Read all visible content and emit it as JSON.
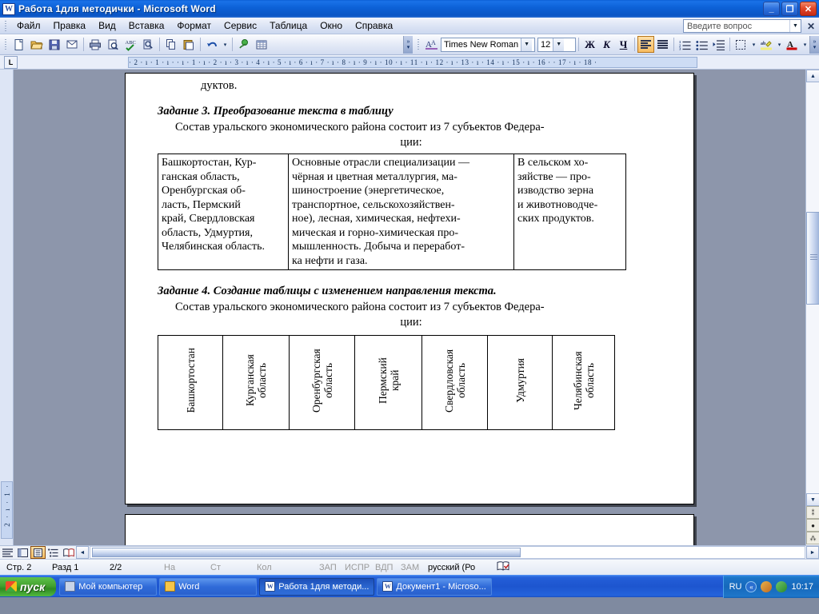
{
  "window": {
    "title": "Работа 1для методички - Microsoft Word",
    "icon": "word-document-icon",
    "minimize": "_",
    "maximize": "❐",
    "close": "✕"
  },
  "menu": {
    "items": [
      {
        "label": "Файл"
      },
      {
        "label": "Правка"
      },
      {
        "label": "Вид"
      },
      {
        "label": "Вставка"
      },
      {
        "label": "Формат"
      },
      {
        "label": "Сервис"
      },
      {
        "label": "Таблица"
      },
      {
        "label": "Окно"
      },
      {
        "label": "Справка"
      }
    ],
    "ask_placeholder": "Введите вопрос",
    "ask_close": "✕"
  },
  "toolbar": {
    "standard_icons": [
      "new-document-icon",
      "open-folder-icon",
      "save-icon",
      "email-icon",
      "print-icon",
      "print-preview-icon",
      "spelling-check-icon",
      "research-icon",
      "copy-icon",
      "paste-icon",
      "undo-icon",
      "undo-dropdown-icon",
      "insert-hyperlink-icon",
      "insert-table-icon"
    ],
    "overflow": "toolbar-options-icon",
    "font_name": "Times New Roman",
    "font_size": "12",
    "bold": "Ж",
    "italic": "К",
    "underline": "Ч",
    "align_left": "align-left-icon",
    "align_justify": "align-justify-icon",
    "numbered_list": "numbered-list-icon",
    "bulleted_list": "bulleted-list-icon",
    "increase_indent": "increase-indent-icon",
    "borders": "borders-icon",
    "highlight": "highlight-icon",
    "font_color": "font-color-icon",
    "dropdown_arrow": "▾"
  },
  "ruler": {
    "tab_selector": "L",
    "horizontal_marks": "·  2  ·  ı  ·  1  ·  ı  ·      ·  ı  ·  1  ·  ı  ·  2  ·  ı  ·  3  ·  ı  ·  4  ·  ı  ·  5  ·  ı  ·  6  ·  ı  ·  7  ·  ı  ·  8  ·  ı  ·  9  ·  ı  · 10 ·  ı  · 11 ·  ı  · 12 ·  ı  · 13 ·  ı  · 14 ·  ı  · 15 ·  ı  · 16 ·      · 17 ·  ı  · 18 ·",
    "vertical_marks": "2 · ı · 1 ·"
  },
  "document": {
    "continued_line": "дуктов.",
    "task3": {
      "heading": "Задание 3. Преобразование текста в таблицу",
      "intro": "Состав уральского экономического района состоит из 7 субъектов Федера-",
      "intro2": "ции:",
      "table": {
        "cells": [
          "Башкортостан, Кур-ганская область, Оренбургская об-ласть, Пермский край, Свердловская область, Удмуртия, Челябинская область.",
          "Основные отрасли специализации — чёрная и цветная металлургия, ма-шиностроение (энергетическое, транспортное, сельскохозяйствен-ное), лесная, химическая, нефтехи-мическая и горно-химическая про-мышленность. Добыча и переработ-ка нефти и газа.",
          "В сельском хо-зяйстве — про-изводство зерна и животноводче-ских продуктов."
        ],
        "cell0_lines": [
          "Башкортостан, Кур-",
          "ганская область,",
          "Оренбургская об-",
          "ласть, Пермский",
          "край, Свердловская",
          "область, Удмуртия,",
          "Челябинская область."
        ],
        "cell1_lines": [
          "Основные отрасли специализации —",
          "чёрная и цветная металлургия, ма-",
          "шиностроение (энергетическое,",
          "транспортное, сельскохозяйствен-",
          "ное), лесная, химическая, нефтехи-",
          "мическая и горно-химическая про-",
          "мышленность. Добыча и переработ-",
          "ка нефти и газа."
        ],
        "cell2_lines": [
          "В сельском хо-",
          "зяйстве — про-",
          "изводство зерна",
          "и животноводче-",
          "ских продуктов."
        ]
      }
    },
    "task4": {
      "heading": "Задание 4. Создание таблицы с изменением направления текста.",
      "intro": "Состав уральского экономического района состоит из 7 субъектов Федера-",
      "intro2": "ции:",
      "vertical_table": {
        "cells": [
          "Башкортостан",
          "Курганская область",
          "Оренбургская область",
          "Пермский край",
          "Свердловская область",
          "Удмуртия",
          "Челябинская область"
        ]
      }
    }
  },
  "scrollbars": {
    "up_arrow": "▲",
    "down_arrow": "▼",
    "left_arrow": "◄",
    "right_arrow": "►",
    "prev_page": "⁑",
    "select_object": "●",
    "next_page": "⁂"
  },
  "view_buttons": [
    {
      "name": "normal-view",
      "glyph": "≡",
      "active": false
    },
    {
      "name": "web-layout-view",
      "glyph": "◪",
      "active": false
    },
    {
      "name": "print-layout-view",
      "glyph": "▤",
      "active": true
    },
    {
      "name": "outline-view",
      "glyph": "⋮≡",
      "active": false
    },
    {
      "name": "reading-layout-view",
      "glyph": "▥",
      "active": false
    }
  ],
  "statusbar": {
    "items": [
      {
        "label": "Стр. 2",
        "dim": false
      },
      {
        "label": "Разд 1",
        "dim": false
      },
      {
        "label": "2/2",
        "dim": false
      },
      {
        "label": "На",
        "dim": true
      },
      {
        "label": "Ст",
        "dim": true
      },
      {
        "label": "Кол",
        "dim": true
      },
      {
        "label": "ЗАП",
        "dim": true
      },
      {
        "label": "ИСПР",
        "dim": true
      },
      {
        "label": "ВДП",
        "dim": true
      },
      {
        "label": "ЗАМ",
        "dim": true
      },
      {
        "label": "русский (Ро",
        "dim": false
      }
    ],
    "spell_icon": "spell-check-status-icon"
  },
  "taskbar": {
    "start": "пуск",
    "tasks": [
      {
        "label": "Мой компьютер",
        "icon": "my-computer-icon",
        "active": false
      },
      {
        "label": "Word",
        "icon": "folder-icon",
        "active": false
      },
      {
        "label": "Работа 1для методи...",
        "icon": "word-document-icon",
        "active": true
      },
      {
        "label": "Документ1 - Microso...",
        "icon": "word-document-icon",
        "active": false
      }
    ],
    "language": "RU",
    "clock": "10:17",
    "tray_icons": [
      "show-hidden-icons",
      "network-icon",
      "volume-icon"
    ]
  },
  "colors": {
    "titlebar_blue": "#0a55c4",
    "taskbar_blue": "#1d55cf",
    "start_green": "#43a12f",
    "workspace_gray": "#8d96ab",
    "toolbar_face": "#e4eaf7",
    "highlight_orange": "#f8bd63"
  }
}
